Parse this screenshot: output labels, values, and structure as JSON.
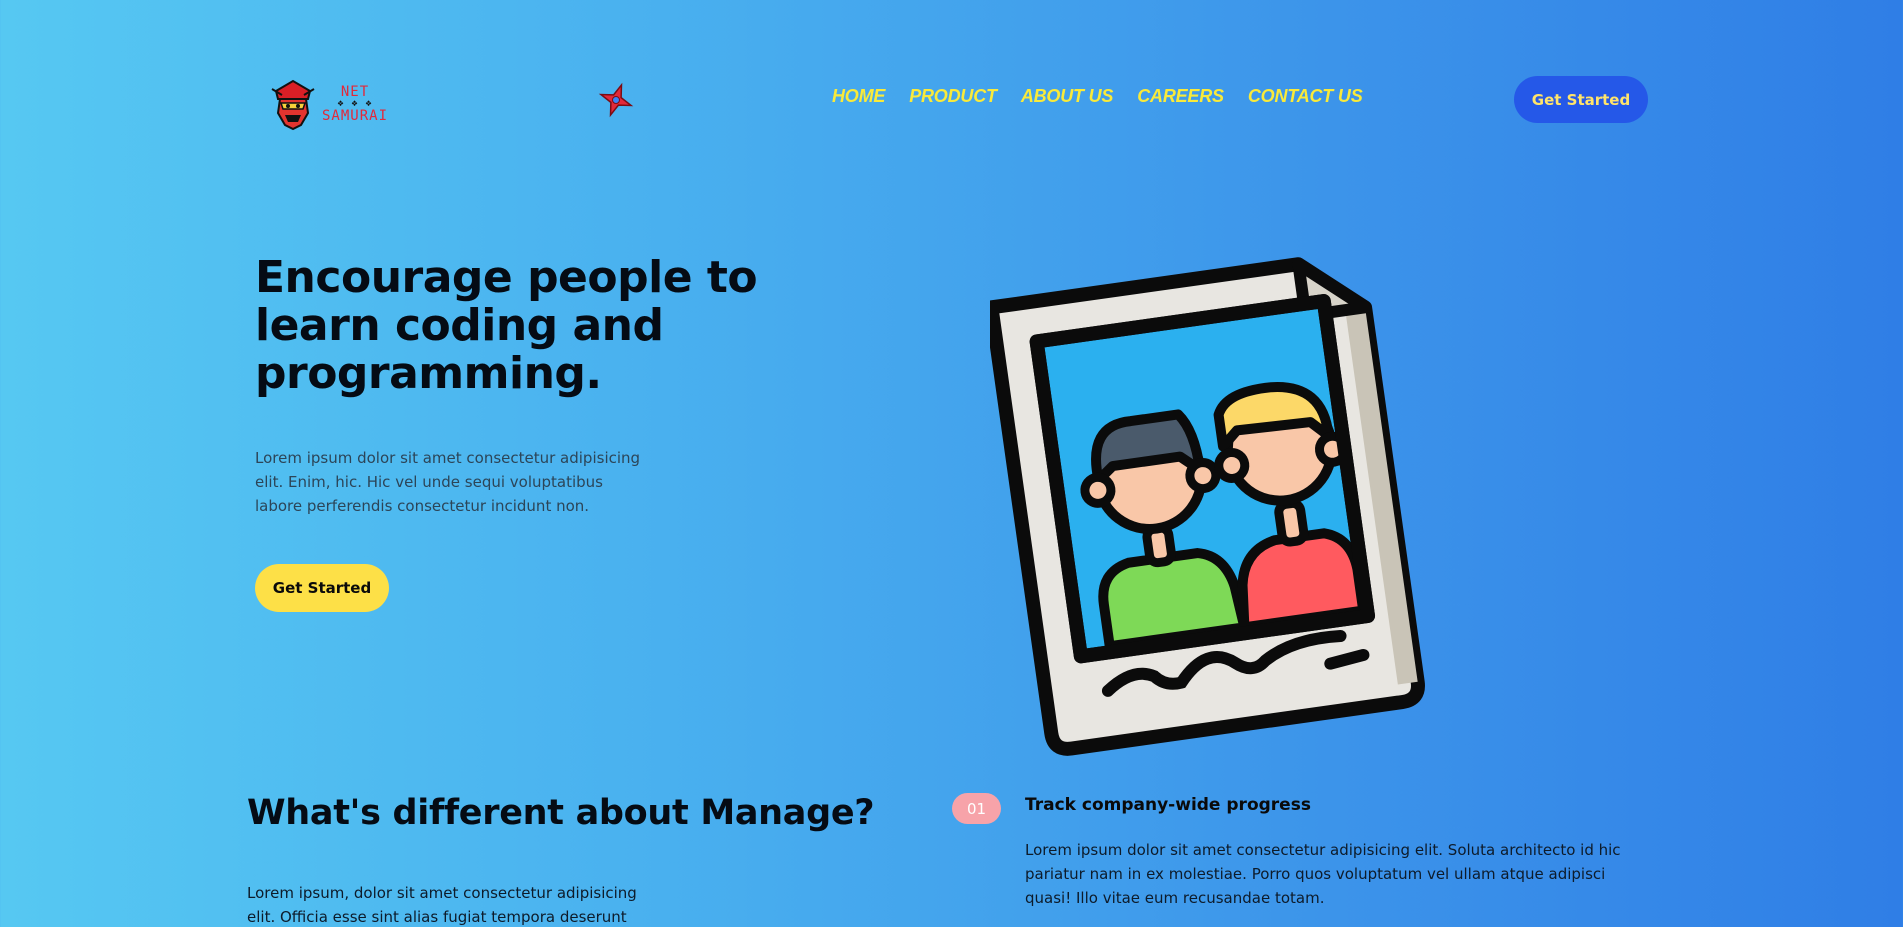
{
  "brand": {
    "line1": "NET",
    "stars": "❖ ❖ ❖",
    "line2": "SAMURAI"
  },
  "nav": {
    "items": [
      "HOME",
      "PRODUCT",
      "ABOUT US",
      "CAREERS",
      "CONTACT US"
    ]
  },
  "header": {
    "cta_label": "Get Started"
  },
  "hero": {
    "title": "Encourage people to learn coding and programming.",
    "description": "Lorem ipsum dolor sit amet consectetur adipisicing elit. Enim, hic. Hic vel unde sequi voluptatibus labore perferendis consectetur incidunt non.",
    "cta_label": "Get Started"
  },
  "section": {
    "title": "What's different about Manage?",
    "description": "Lorem ipsum, dolor sit amet consectetur adipisicing elit. Officia esse sint alias fugiat tempora deserunt"
  },
  "features": [
    {
      "number": "01",
      "title": "Track company-wide progress",
      "description": "Lorem ipsum dolor sit amet consectetur adipisicing elit. Soluta architecto id hic pariatur nam in ex molestiae. Porro quos voluptatum vel ullam atque adipisci quasi! Illo vitae eum recusandae totam."
    }
  ],
  "colors": {
    "nav_text": "#f9ea3a",
    "header_button": "#2558e8",
    "hero_button": "#fde047",
    "feature_badge": "#f7a3a9"
  }
}
